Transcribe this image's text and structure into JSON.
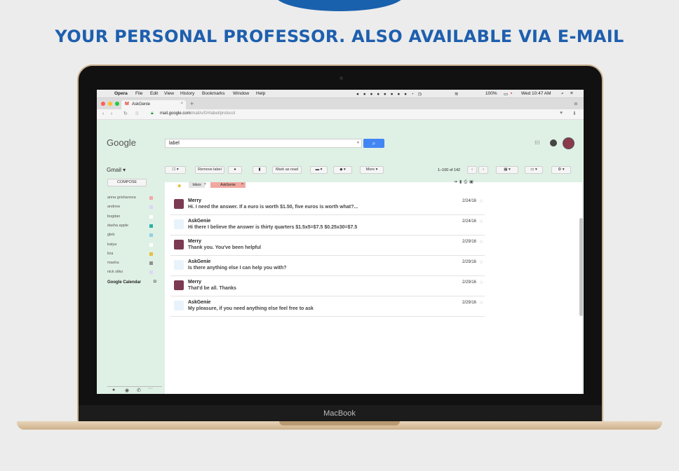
{
  "headline": "YOUR PERSONAL PROFESSOR. ALSO AVAILABLE VIA E-MAIL",
  "device_label": "MacBook",
  "menubar": {
    "app": "Opera",
    "items": [
      "File",
      "Edit",
      "View",
      "History",
      "Bookmarks",
      "Window",
      "Help"
    ],
    "battery": "100%",
    "clock": "Wed 10:47 AM"
  },
  "browser": {
    "tab_title": "AskGenie",
    "new_tab": "+",
    "url_host": "mail.google.com",
    "url_path": "/mail/u/0/#label/protocol"
  },
  "gmail": {
    "logo": "Google",
    "search_value": "label",
    "app_menu": "Gmail ▾",
    "compose": "COMPOSE",
    "toolbar": {
      "remove_label": "Remove label",
      "mark_as_read": "Mark as read",
      "more": "More ▾",
      "pagination": "1–100 of 142"
    },
    "labels": [
      "anna grishanova",
      "andrew",
      "bogdan",
      "dasha apple",
      "gleb",
      "katya",
      "liza",
      "masha",
      "nick silko"
    ],
    "label_colors": [
      "#f4a6a6",
      "#dcd6f7",
      "#ffffff",
      "#2bb0a6",
      "#8fd1e6",
      "#ffffff",
      "#e8c040",
      "#8f8f8f",
      "#dcd6f7"
    ],
    "google_calendar": "Google Calendar",
    "filter_chips": [
      "Inbox",
      "AskGenie"
    ],
    "emails": [
      {
        "sender": "Merry",
        "snippet": "Hi. I need the answer. If a euro is worth $1.50, five euros is worth what?...",
        "date": "2/24/16"
      },
      {
        "sender": "AskGenie",
        "snippet": "Hi there I believe the answer is thirty quarters $1.5x5=$7.5 $0.25x30=$7.5",
        "date": "2/24/16"
      },
      {
        "sender": "Merry",
        "snippet": "Thank you. You've been helpful",
        "date": "2/29/16"
      },
      {
        "sender": "AskGenie",
        "snippet": "Is there anything else I can help you with?",
        "date": "2/29/16"
      },
      {
        "sender": "Merry",
        "snippet": "That'd be all. Thanks",
        "date": "2/29/16"
      },
      {
        "sender": "AskGenie",
        "snippet": "My pleasure, if you need anything else feel free to ask",
        "date": "2/29/16"
      }
    ]
  }
}
